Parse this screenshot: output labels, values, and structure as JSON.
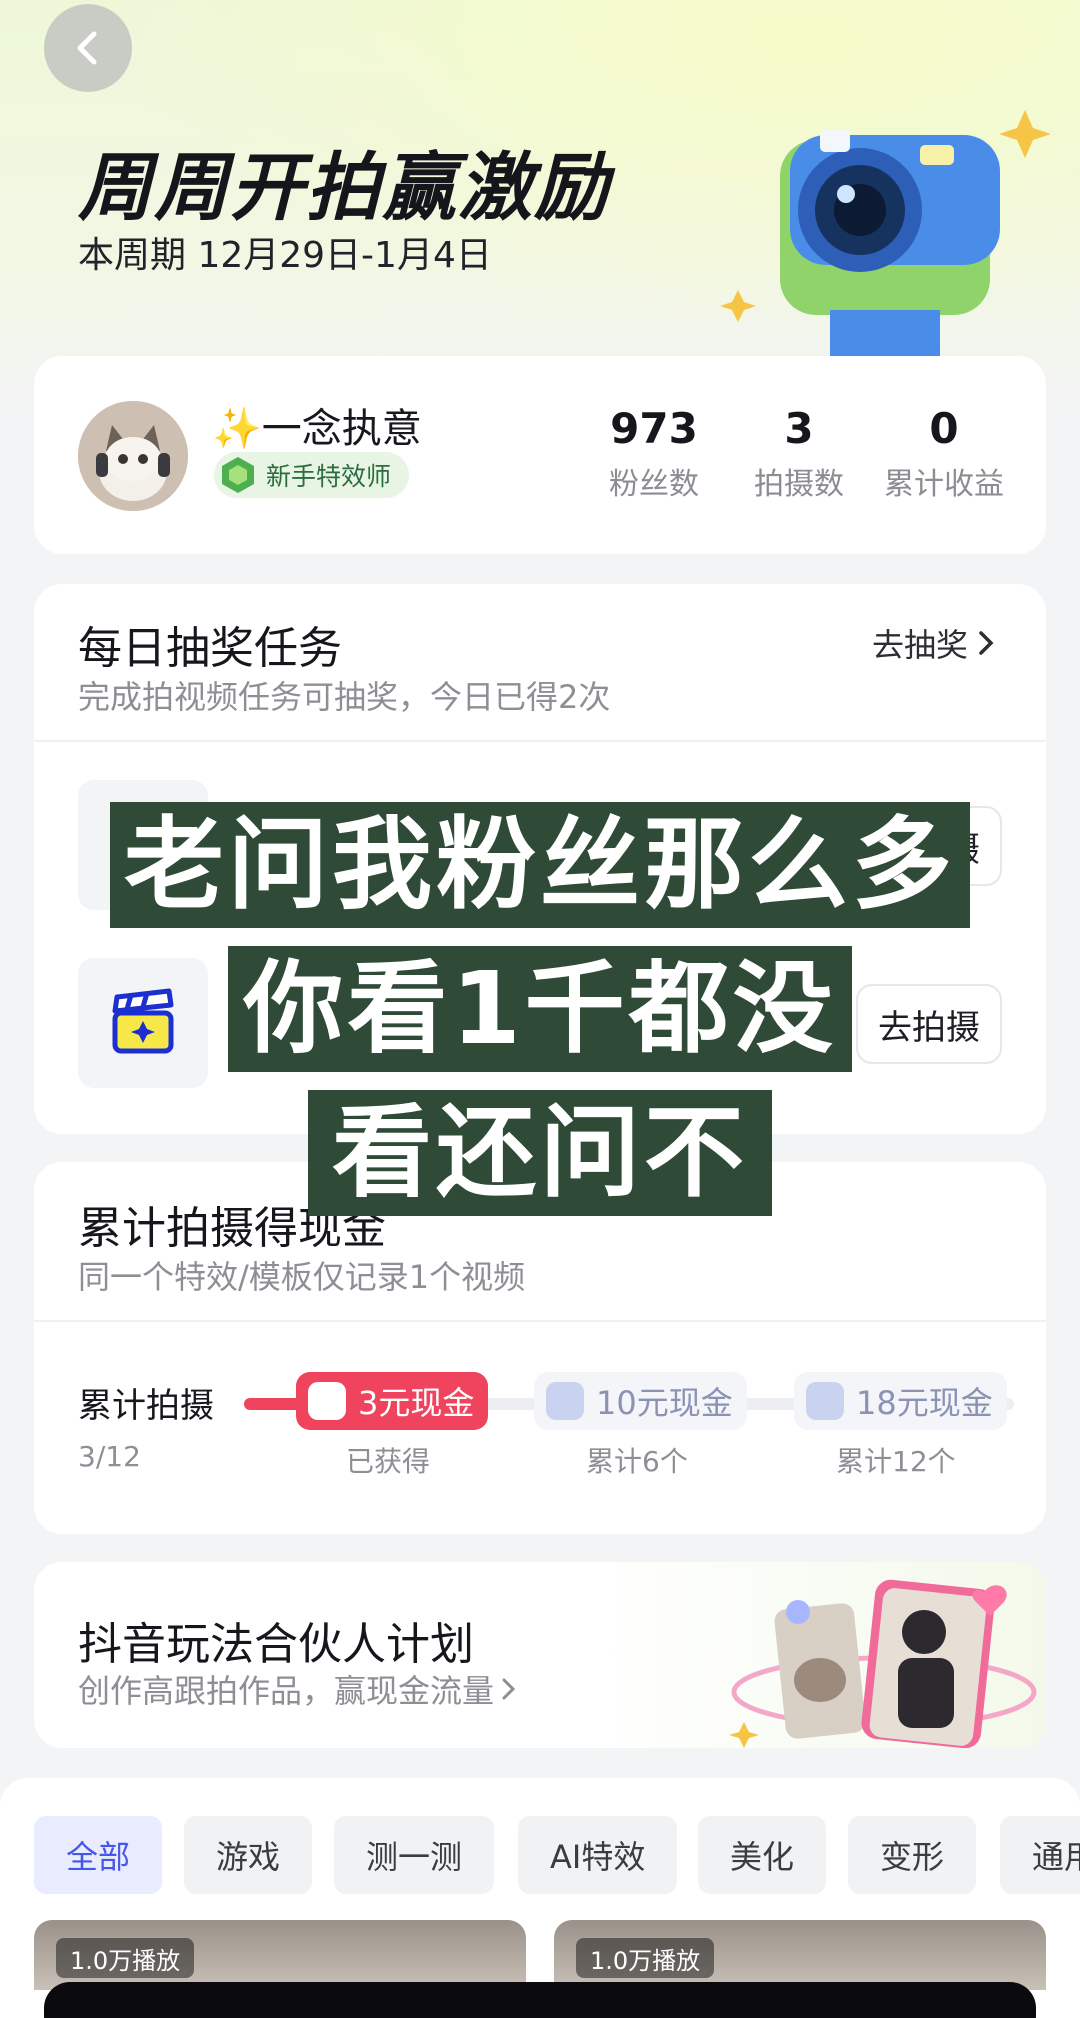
{
  "header": {
    "back_icon": "chevron-left-icon",
    "title": "周周开拍赢激励",
    "subtitle": "本周期 12月29日-1月4日"
  },
  "profile": {
    "name": "✨一念执意",
    "badge": "新手特效师",
    "stats": [
      {
        "value": "973",
        "label": "粉丝数"
      },
      {
        "value": "3",
        "label": "拍摄数"
      },
      {
        "value": "0",
        "label": "累计收益"
      }
    ]
  },
  "daily": {
    "title": "每日抽奖任务",
    "subtitle": "完成拍视频任务可抽奖，今日已得2次",
    "link": "去抽奖",
    "task_button_partial": "摄",
    "task_button": "去拍摄"
  },
  "caption": {
    "lines": [
      "老问我粉丝那么多",
      "你看1千都没",
      "看还问不"
    ]
  },
  "cumulative": {
    "title": "累计拍摄得现金",
    "subtitle": "同一个特效/模板仅记录1个视频",
    "progress_label": "累计拍摄",
    "progress_count": "3/12",
    "progress_fraction": 0.25,
    "rewards": [
      {
        "label": "3元现金",
        "note": "已获得",
        "achieved": true
      },
      {
        "label": "10元现金",
        "note": "累计6个",
        "achieved": false
      },
      {
        "label": "18元现金",
        "note": "累计12个",
        "achieved": false
      }
    ]
  },
  "partner": {
    "title": "抖音玩法合伙人计划",
    "subtitle": "创作高跟拍作品，赢现金流量"
  },
  "tabs": [
    "全部",
    "游戏",
    "测一测",
    "AI特效",
    "美化",
    "变形",
    "通用"
  ],
  "feed": {
    "tags": [
      "1.0万播放",
      "1.0万播放"
    ]
  },
  "colors": {
    "accent": "#4656e6",
    "reward_red": "#f0445e",
    "caption_bg": "#2f4a36"
  }
}
